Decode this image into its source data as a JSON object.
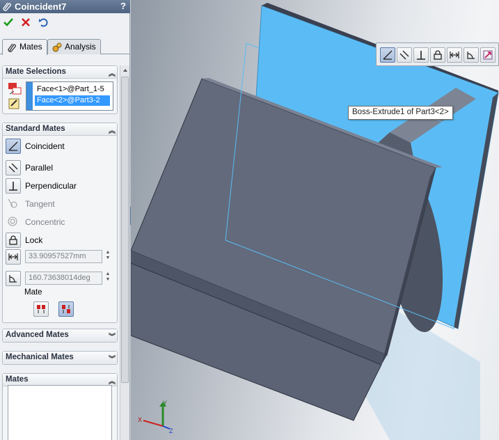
{
  "window": {
    "title": "Coincident7",
    "help": "?"
  },
  "toolbar": {
    "ok": "check-icon",
    "cancel": "x-icon",
    "undo": "undo-icon"
  },
  "tabs": [
    {
      "label": "Mates",
      "icon": "paperclip-icon",
      "active": true
    },
    {
      "label": "Analysis",
      "icon": "gears-icon",
      "active": false
    }
  ],
  "mate_selections": {
    "title": "Mate Selections",
    "items": [
      "Face<1>@Part_1-5",
      "Face<2>@Part3-2"
    ]
  },
  "standard_mates": {
    "title": "Standard Mates",
    "coincident": "Coincident",
    "parallel": "Parallel",
    "perpendicular": "Perpendicular",
    "tangent": "Tangent",
    "concentric": "Concentric",
    "lock": "Lock",
    "distance_value": "33.90957527mm",
    "angle_value": "160.73638014deg",
    "mate_alignment_label": "Mate"
  },
  "advanced_mates": {
    "title": "Advanced Mates"
  },
  "mechanical_mates": {
    "title": "Mechanical Mates"
  },
  "mates": {
    "title": "Mates"
  },
  "graphics": {
    "tooltip": "Boss-Extrude1 of Part3<2>",
    "selection_color": "#5bbcf5",
    "part_color": "#626a7c",
    "triad": {
      "x": "X",
      "y": "Y",
      "z": "Z"
    }
  }
}
